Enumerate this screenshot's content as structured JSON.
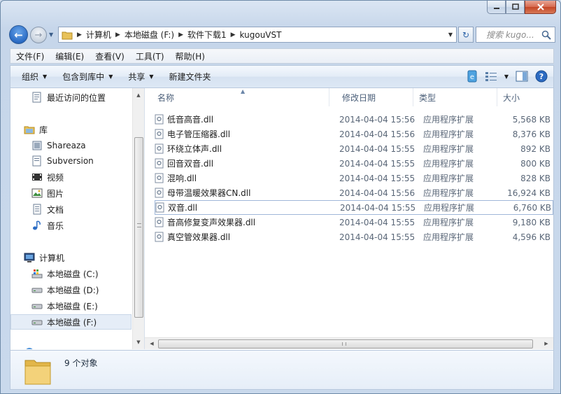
{
  "window": {
    "caption": {
      "minimize": "minimize",
      "maximize": "maximize",
      "close": "close"
    }
  },
  "address": {
    "crumbs": [
      "计算机",
      "本地磁盘 (F:)",
      "软件下载1",
      "kugouVST"
    ],
    "search_placeholder": "搜索 kugo..."
  },
  "menu": [
    "文件(F)",
    "编辑(E)",
    "查看(V)",
    "工具(T)",
    "帮助(H)"
  ],
  "commands": {
    "organize": "组织",
    "include_library": "包含到库中",
    "share": "共享",
    "new_folder": "新建文件夹"
  },
  "nav": {
    "recent": "最近访问的位置",
    "libraries": "库",
    "lib_items": [
      "Shareaza",
      "Subversion",
      "视频",
      "图片",
      "文档",
      "音乐"
    ],
    "computer": "计算机",
    "drives": [
      "本地磁盘 (C:)",
      "本地磁盘 (D:)",
      "本地磁盘 (E:)",
      "本地磁盘 (F:)"
    ]
  },
  "columns": {
    "name": "名称",
    "date": "修改日期",
    "type": "类型",
    "size": "大小"
  },
  "files": [
    {
      "name": "低音高音.dll",
      "date": "2014-04-04 15:56",
      "type": "应用程序扩展",
      "size": "5,568 KB"
    },
    {
      "name": "电子管压缩器.dll",
      "date": "2014-04-04 15:56",
      "type": "应用程序扩展",
      "size": "8,376 KB"
    },
    {
      "name": "环绕立体声.dll",
      "date": "2014-04-04 15:55",
      "type": "应用程序扩展",
      "size": "892 KB"
    },
    {
      "name": "回音双音.dll",
      "date": "2014-04-04 15:55",
      "type": "应用程序扩展",
      "size": "800 KB"
    },
    {
      "name": "混响.dll",
      "date": "2014-04-04 15:55",
      "type": "应用程序扩展",
      "size": "828 KB"
    },
    {
      "name": "母带温暖效果器CN.dll",
      "date": "2014-04-04 15:56",
      "type": "应用程序扩展",
      "size": "16,924 KB"
    },
    {
      "name": "双音.dll",
      "date": "2014-04-04 15:55",
      "type": "应用程序扩展",
      "size": "6,760 KB"
    },
    {
      "name": "音高修复变声效果器.dll",
      "date": "2014-04-04 15:55",
      "type": "应用程序扩展",
      "size": "9,180 KB"
    },
    {
      "name": "真空管效果器.dll",
      "date": "2014-04-04 15:55",
      "type": "应用程序扩展",
      "size": "4,596 KB"
    }
  ],
  "status": {
    "count": "9 个对象"
  }
}
